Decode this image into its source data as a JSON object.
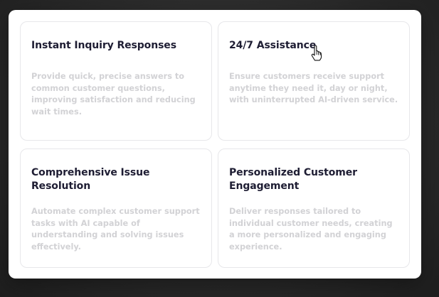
{
  "features": {
    "instant": {
      "title": "Instant Inquiry Responses",
      "description": "Provide quick, precise answers to common customer questions, improving satisfaction and reducing wait times."
    },
    "assistance": {
      "title": "24/7 Assistance",
      "description": "Ensure customers receive support anytime they need it, day or night, with uninterrupted AI-driven service."
    },
    "resolution": {
      "title": "Comprehensive Issue Resolution",
      "description": "Automate complex customer support tasks with AI capable of understanding and solving issues effectively."
    },
    "engagement": {
      "title": "Personalized Customer Engagement",
      "description": "Deliver responses tailored to individual customer needs, creating a more personalized and engaging experience."
    }
  },
  "icons": {
    "cursor": "pointer-hand-icon"
  },
  "colors": {
    "title": "#1e1d33",
    "description": "#d2d2d5",
    "card_border": "#e7e7ea",
    "background": "#ffffff"
  }
}
